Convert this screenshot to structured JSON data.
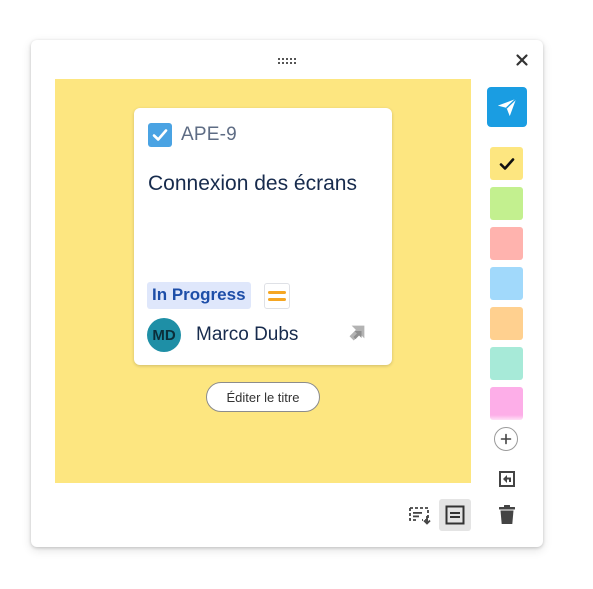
{
  "card": {
    "issue_key": "APE-9",
    "title": "Connexion des écrans",
    "status": "In Progress",
    "assignee_initials": "MD",
    "assignee_name": "Marco Dubs"
  },
  "actions": {
    "edit_title_label": "Éditer le titre"
  },
  "colors": {
    "sticky_background": "#fde680",
    "accent": "#1a9de2",
    "status_lozenge_bg": "#dfe7fb",
    "status_lozenge_text": "#1d4ea8",
    "priority": "#f5a623",
    "avatar": "#1e8fa6"
  },
  "color_swatches": [
    {
      "color": "#fde680",
      "selected": true
    },
    {
      "color": "#c3f08f",
      "selected": false
    },
    {
      "color": "#ffb3ae",
      "selected": false
    },
    {
      "color": "#a1d9fb",
      "selected": false
    },
    {
      "color": "#ffd08f",
      "selected": false
    },
    {
      "color": "#a7ead8",
      "selected": false
    },
    {
      "color": "#fdaee8",
      "selected": false
    }
  ],
  "icons": {
    "drag": "drag-handle-icon",
    "close": "close-icon",
    "send": "send-icon",
    "check": "check-icon",
    "add": "plus-icon",
    "return": "return-to-board-icon",
    "delete": "trash-icon",
    "issue_type": "task-checkbox-icon",
    "priority": "priority-medium-icon",
    "jira": "jira-icon",
    "insert_fields": "insert-fields-icon",
    "card_view": "card-view-icon"
  }
}
